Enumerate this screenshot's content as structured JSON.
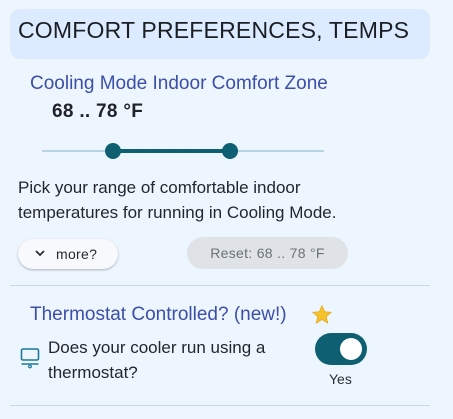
{
  "header": {
    "title": "COMFORT PREFERENCES, TEMPS"
  },
  "cooling": {
    "title": "Cooling Mode Indoor Comfort Zone",
    "range_text": "68 .. 78 °F",
    "slider": {
      "low": 68,
      "high": 78,
      "min": 62,
      "max": 86
    },
    "description": "Pick your range of comfortable indoor temperatures for running in Cooling Mode.",
    "more_label": "more?",
    "reset_label": "Reset: 68 .. 78 °F"
  },
  "thermostat": {
    "title": "Thermostat Controlled?  (new!)",
    "question": "Does your cooler run using a thermostat?",
    "toggle_on": true,
    "toggle_label": "Yes"
  },
  "colors": {
    "accent": "#0f5f73",
    "title_blue": "#3b4fa8",
    "header_bg": "#dcebff"
  },
  "icons": [
    "chevron-down-icon",
    "star-icon",
    "monitor-icon"
  ]
}
